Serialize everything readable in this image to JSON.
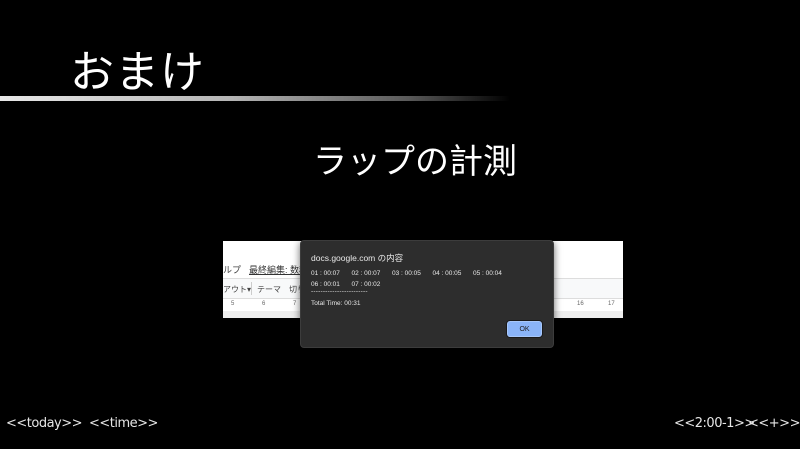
{
  "slide": {
    "title": "おまけ",
    "subtitle": "ラップの計測"
  },
  "editor": {
    "menu_help": "ルプ",
    "menu_last_edit": "最終編集: 数秒",
    "toolbar_layout": "アウト▾",
    "toolbar_theme": "テーマ",
    "toolbar_cut": "切り",
    "ruler_ticks": [
      "5",
      "6",
      "7",
      "16",
      "17"
    ]
  },
  "dialog": {
    "title": "docs.google.com の内容",
    "laps_row1": [
      "01 : 00:07",
      "02 : 00:07",
      "03 : 00:05",
      "04 : 00:05",
      "05 : 00:04"
    ],
    "laps_row2": [
      "06 : 00:01",
      "07 : 00:02"
    ],
    "separator": "------------------------",
    "total": "Total Time: 00:31",
    "ok_label": "OK"
  },
  "nav": {
    "today": "<<today>>",
    "time": "<<time>>",
    "page": "<<2:00-1>>",
    "plus": "<<+>>"
  },
  "colors": {
    "background": "#000000",
    "dialog_bg": "#2d2d2d",
    "ok_button": "#8ab4f8"
  }
}
